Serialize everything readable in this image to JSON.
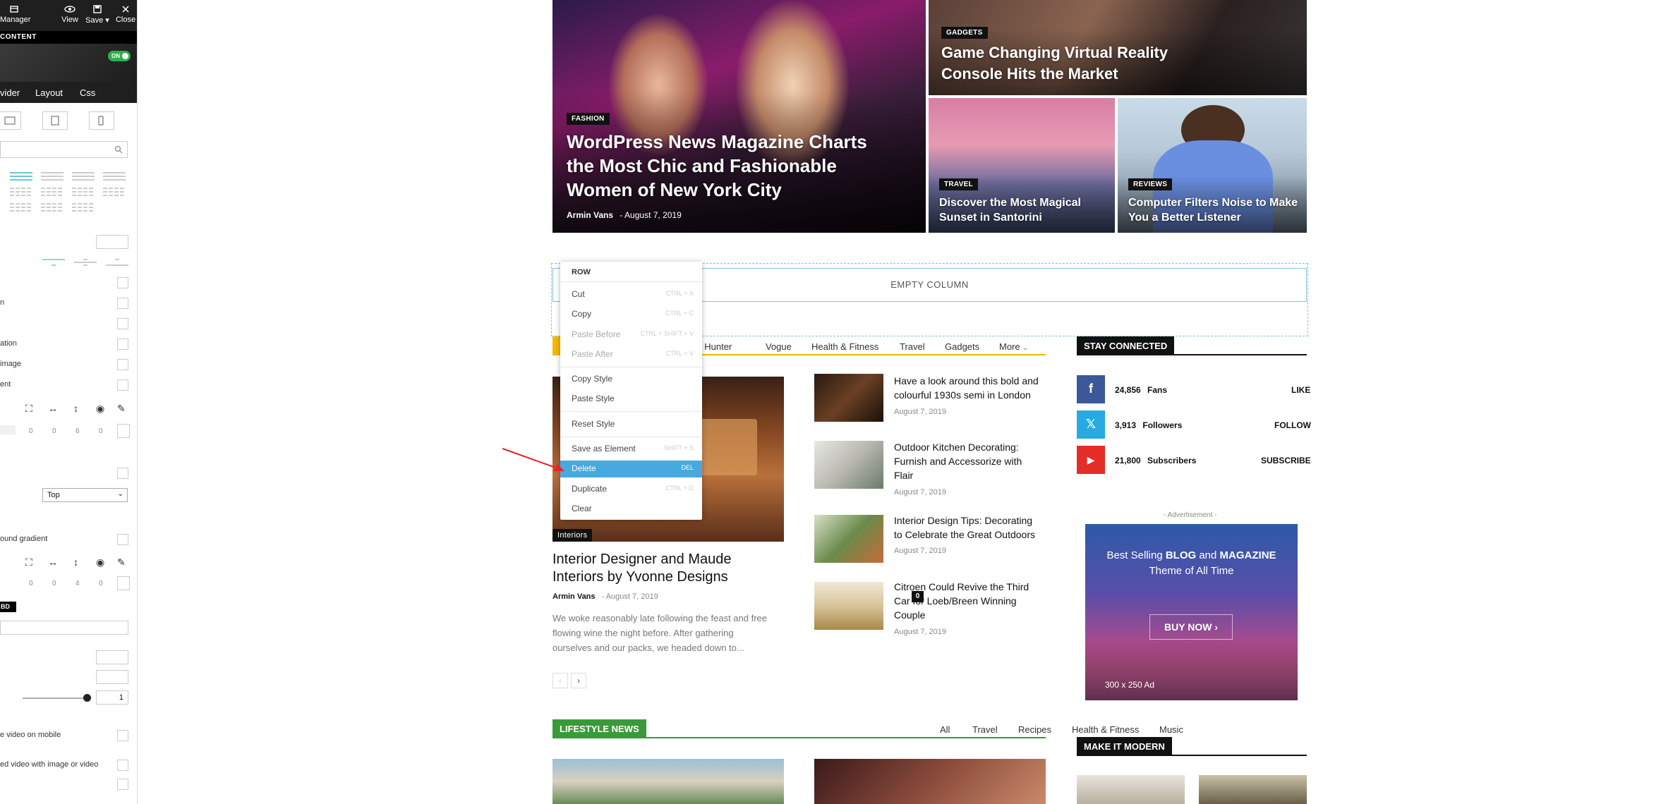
{
  "panel": {
    "toolbar": {
      "manager": "Manager",
      "view": "View",
      "save": "Save ▾",
      "close": "Close"
    },
    "content_label": "CONTENT",
    "on_label": "ON",
    "tabs": [
      "vider",
      "Layout",
      "Css"
    ],
    "labels": {
      "l1": "n",
      "l2": "ation",
      "l3": "image",
      "l4": "ent",
      "l5": "ound gradient",
      "l6": "e video on mobile",
      "l7": "ed video with image or video"
    },
    "numbers_row1": [
      "0",
      "0",
      "6",
      "0"
    ],
    "numbers_row2": [
      "0",
      "0",
      "4",
      "0"
    ],
    "select_value": "Top",
    "bd_chip": "BD",
    "slider_value": "1"
  },
  "hero": {
    "main": {
      "badge": "FASHION",
      "title_lines": [
        "WordPress News Magazine Charts",
        "the Most Chic and Fashionable",
        "Women of New York City"
      ],
      "author": "Armin Vans",
      "date": "August 7, 2019"
    },
    "top_right": {
      "badge": "GADGETS",
      "title_lines": [
        "Game Changing Virtual Reality",
        "Console Hits the Market"
      ]
    },
    "travel": {
      "badge": "TRAVEL",
      "title_lines": [
        "Discover the Most Magical",
        "Sunset in Santorini"
      ]
    },
    "reviews": {
      "badge": "REVIEWS",
      "title_lines": [
        "Computer Filters Noise to Make",
        "You a Better Listener"
      ]
    }
  },
  "empty_column": "EMPTY COLUMN",
  "context_menu": {
    "title": "ROW",
    "items": [
      {
        "label": "Cut",
        "shortcut": "CTRL + X",
        "disabled": false
      },
      {
        "label": "Copy",
        "shortcut": "CTRL + C",
        "disabled": false
      },
      {
        "label": "Paste Before",
        "shortcut": "CTRL + SHIFT + V",
        "disabled": true
      },
      {
        "label": "Paste After",
        "shortcut": "CTRL + V",
        "disabled": true
      },
      {
        "label": "Copy Style",
        "shortcut": "",
        "disabled": false
      },
      {
        "label": "Paste Style",
        "shortcut": "",
        "disabled": false
      },
      {
        "label": "Reset Style",
        "shortcut": "",
        "disabled": false
      },
      {
        "label": "Save as Element",
        "shortcut": "SHIFT + S",
        "disabled": false
      },
      {
        "label": "Delete",
        "shortcut": "DEL",
        "disabled": false,
        "active": true
      },
      {
        "label": "Duplicate",
        "shortcut": "CTRL + D",
        "disabled": false
      },
      {
        "label": "Clear",
        "shortcut": "",
        "disabled": false
      }
    ]
  },
  "block1": {
    "tabs": [
      "yle Hunter",
      "Vogue",
      "Health & Fitness",
      "Travel",
      "Gadgets",
      "More"
    ],
    "accent": "#f5b800",
    "main_post": {
      "badge": "Interiors",
      "title_lines": [
        "Interior Designer and Maude",
        "Interiors by Yvonne Designs"
      ],
      "author": "Armin Vans",
      "date": "August 7, 2019",
      "comments": "0",
      "excerpt_lines": [
        "We woke reasonably late following the feast and free",
        "flowing wine the night before. After gathering",
        "ourselves and our packs, we headed down to..."
      ]
    },
    "side_posts": [
      {
        "title_lines": [
          "Have a look around this bold and",
          "colourful 1930s semi in London"
        ],
        "date": "August 7, 2019"
      },
      {
        "title_lines": [
          "Outdoor Kitchen Decorating:",
          "Furnish and Accessorize with",
          "Flair"
        ],
        "date": "August 7, 2019"
      },
      {
        "title_lines": [
          "Interior Design Tips: Decorating",
          "to Celebrate the Great Outdoors"
        ],
        "date": "August 7, 2019"
      },
      {
        "title_lines": [
          "Citroen Could Revive the Third",
          "Car for Loeb/Breen Winning",
          "Couple"
        ],
        "date": "August 7, 2019"
      }
    ],
    "pagination": [
      "‹",
      "›"
    ]
  },
  "stay_connected": {
    "title": "STAY CONNECTED",
    "rows": [
      {
        "icon": "facebook-icon",
        "glyph": "f",
        "color": "#3b5998",
        "count": "24,856",
        "unit": "Fans",
        "action": "LIKE"
      },
      {
        "icon": "x-icon",
        "glyph": "𝕏",
        "color": "#29a9e1",
        "count": "3,913",
        "unit": "Followers",
        "action": "FOLLOW"
      },
      {
        "icon": "youtube-icon",
        "glyph": "▶",
        "color": "#e52d27",
        "count": "21,800",
        "unit": "Subscribers",
        "action": "SUBSCRIBE"
      }
    ]
  },
  "ad": {
    "label": "- Advertisement -",
    "line1_pre": "Best Selling ",
    "line1_b1": "BLOG",
    "line1_mid": " and ",
    "line1_b2": "MAGAZINE",
    "line2": "Theme of All Time",
    "button": "BUY NOW  ›",
    "size": "300 x 250 Ad"
  },
  "lifestyle": {
    "title": "LIFESTYLE NEWS",
    "accent": "#3a9a3a",
    "tabs": [
      "All",
      "Travel",
      "Recipes",
      "Health & Fitness",
      "Music"
    ]
  },
  "make_modern": {
    "title": "MAKE IT MODERN"
  }
}
